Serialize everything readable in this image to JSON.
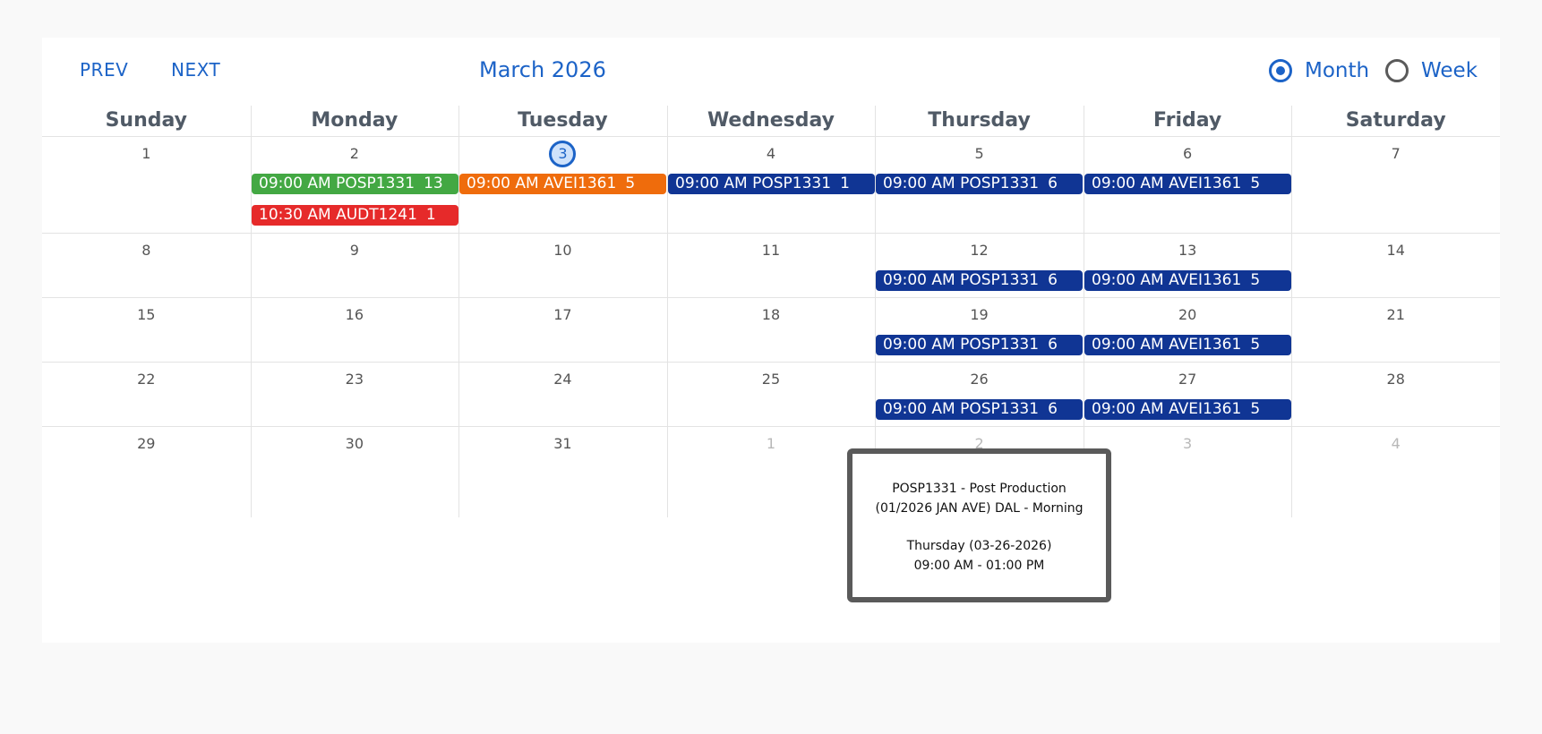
{
  "toolbar": {
    "prev_label": "PREV",
    "next_label": "NEXT",
    "title": "March 2026",
    "views": [
      {
        "label": "Month",
        "selected": true
      },
      {
        "label": "Week",
        "selected": false
      }
    ]
  },
  "weekdays": [
    "Sunday",
    "Monday",
    "Tuesday",
    "Wednesday",
    "Thursday",
    "Friday",
    "Saturday"
  ],
  "weeks": [
    {
      "days": [
        {
          "num": "1"
        },
        {
          "num": "2"
        },
        {
          "num": "3",
          "today": true
        },
        {
          "num": "4"
        },
        {
          "num": "5"
        },
        {
          "num": "6"
        },
        {
          "num": "7"
        }
      ]
    },
    {
      "days": [
        {
          "num": "8"
        },
        {
          "num": "9"
        },
        {
          "num": "10"
        },
        {
          "num": "11"
        },
        {
          "num": "12"
        },
        {
          "num": "13"
        },
        {
          "num": "14"
        }
      ]
    },
    {
      "days": [
        {
          "num": "15"
        },
        {
          "num": "16"
        },
        {
          "num": "17"
        },
        {
          "num": "18"
        },
        {
          "num": "19"
        },
        {
          "num": "20"
        },
        {
          "num": "21"
        }
      ]
    },
    {
      "days": [
        {
          "num": "22"
        },
        {
          "num": "23"
        },
        {
          "num": "24"
        },
        {
          "num": "25"
        },
        {
          "num": "26"
        },
        {
          "num": "27"
        },
        {
          "num": "28"
        }
      ]
    },
    {
      "days": [
        {
          "num": "29"
        },
        {
          "num": "30"
        },
        {
          "num": "31"
        },
        {
          "num": "1",
          "other": true
        },
        {
          "num": "2",
          "other": true
        },
        {
          "num": "3",
          "other": true
        },
        {
          "num": "4",
          "other": true
        }
      ]
    }
  ],
  "events": [
    {
      "week": 0,
      "day": 1,
      "slot": 0,
      "time": "09:00 AM",
      "code": "POSP1331",
      "count": "13",
      "color": "#43a843"
    },
    {
      "week": 0,
      "day": 1,
      "slot": 1,
      "time": "10:30 AM",
      "code": "AUDT1241",
      "count": "1",
      "color": "#e62a2a"
    },
    {
      "week": 0,
      "day": 2,
      "slot": 0,
      "time": "09:00 AM",
      "code": "AVEI1361",
      "count": "5",
      "color": "#ef6c0c"
    },
    {
      "week": 0,
      "day": 3,
      "slot": 0,
      "time": "09:00 AM",
      "code": "POSP1331",
      "count": "1",
      "color": "#103594"
    },
    {
      "week": 0,
      "day": 4,
      "slot": 0,
      "time": "09:00 AM",
      "code": "POSP1331",
      "count": "6",
      "color": "#103594"
    },
    {
      "week": 0,
      "day": 5,
      "slot": 0,
      "time": "09:00 AM",
      "code": "AVEI1361",
      "count": "5",
      "color": "#103594"
    },
    {
      "week": 1,
      "day": 4,
      "slot": 0,
      "time": "09:00 AM",
      "code": "POSP1331",
      "count": "6",
      "color": "#103594"
    },
    {
      "week": 1,
      "day": 5,
      "slot": 0,
      "time": "09:00 AM",
      "code": "AVEI1361",
      "count": "5",
      "color": "#103594"
    },
    {
      "week": 2,
      "day": 4,
      "slot": 0,
      "time": "09:00 AM",
      "code": "POSP1331",
      "count": "6",
      "color": "#103594"
    },
    {
      "week": 2,
      "day": 5,
      "slot": 0,
      "time": "09:00 AM",
      "code": "AVEI1361",
      "count": "5",
      "color": "#103594"
    },
    {
      "week": 3,
      "day": 4,
      "slot": 0,
      "time": "09:00 AM",
      "code": "POSP1331",
      "count": "6",
      "color": "#103594"
    },
    {
      "week": 3,
      "day": 5,
      "slot": 0,
      "time": "09:00 AM",
      "code": "AVEI1361",
      "count": "5",
      "color": "#103594"
    }
  ],
  "tooltip": {
    "line1": "POSP1331 - Post Production",
    "line2": "(01/2026 JAN AVE) DAL - Morning",
    "line3": "Thursday (03-26-2026)",
    "line4": "09:00 AM - 01:00 PM"
  },
  "colors": {
    "accent": "#1c63c7",
    "event_blue": "#103594",
    "event_green": "#43a843",
    "event_red": "#e62a2a",
    "event_orange": "#ef6c0c"
  }
}
